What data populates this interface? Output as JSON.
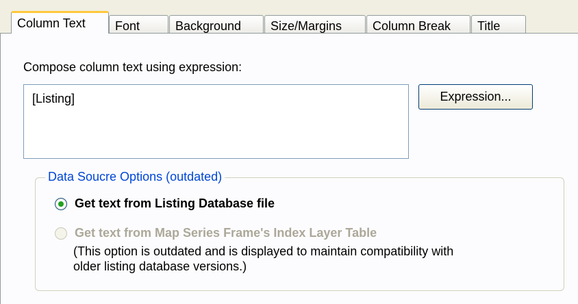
{
  "tabs": [
    {
      "label": "Column Text",
      "active": true
    },
    {
      "label": "Font",
      "active": false
    },
    {
      "label": "Background",
      "active": false
    },
    {
      "label": "Size/Margins",
      "active": false
    },
    {
      "label": "Column Break",
      "active": false
    },
    {
      "label": "Title",
      "active": false
    }
  ],
  "column_text": {
    "prompt": "Compose column text using expression:",
    "expression_value": "[Listing]",
    "expression_button": "Expression..."
  },
  "data_source": {
    "legend": "Data Soucre Options (outdated)",
    "option1": {
      "label": "Get text from Listing Database file",
      "checked": true,
      "enabled": true
    },
    "option2": {
      "label": "Get text from Map Series Frame's Index Layer Table",
      "checked": false,
      "enabled": false
    },
    "note_line1": "(This option is outdated and is displayed to maintain compatibility with",
    "note_line2": "older listing database versions.)"
  },
  "colors": {
    "legend": "#0046d5",
    "active_tab_accent": "#ffc83c",
    "radio_dot": "#21a121",
    "disabled_text": "#aca899"
  }
}
